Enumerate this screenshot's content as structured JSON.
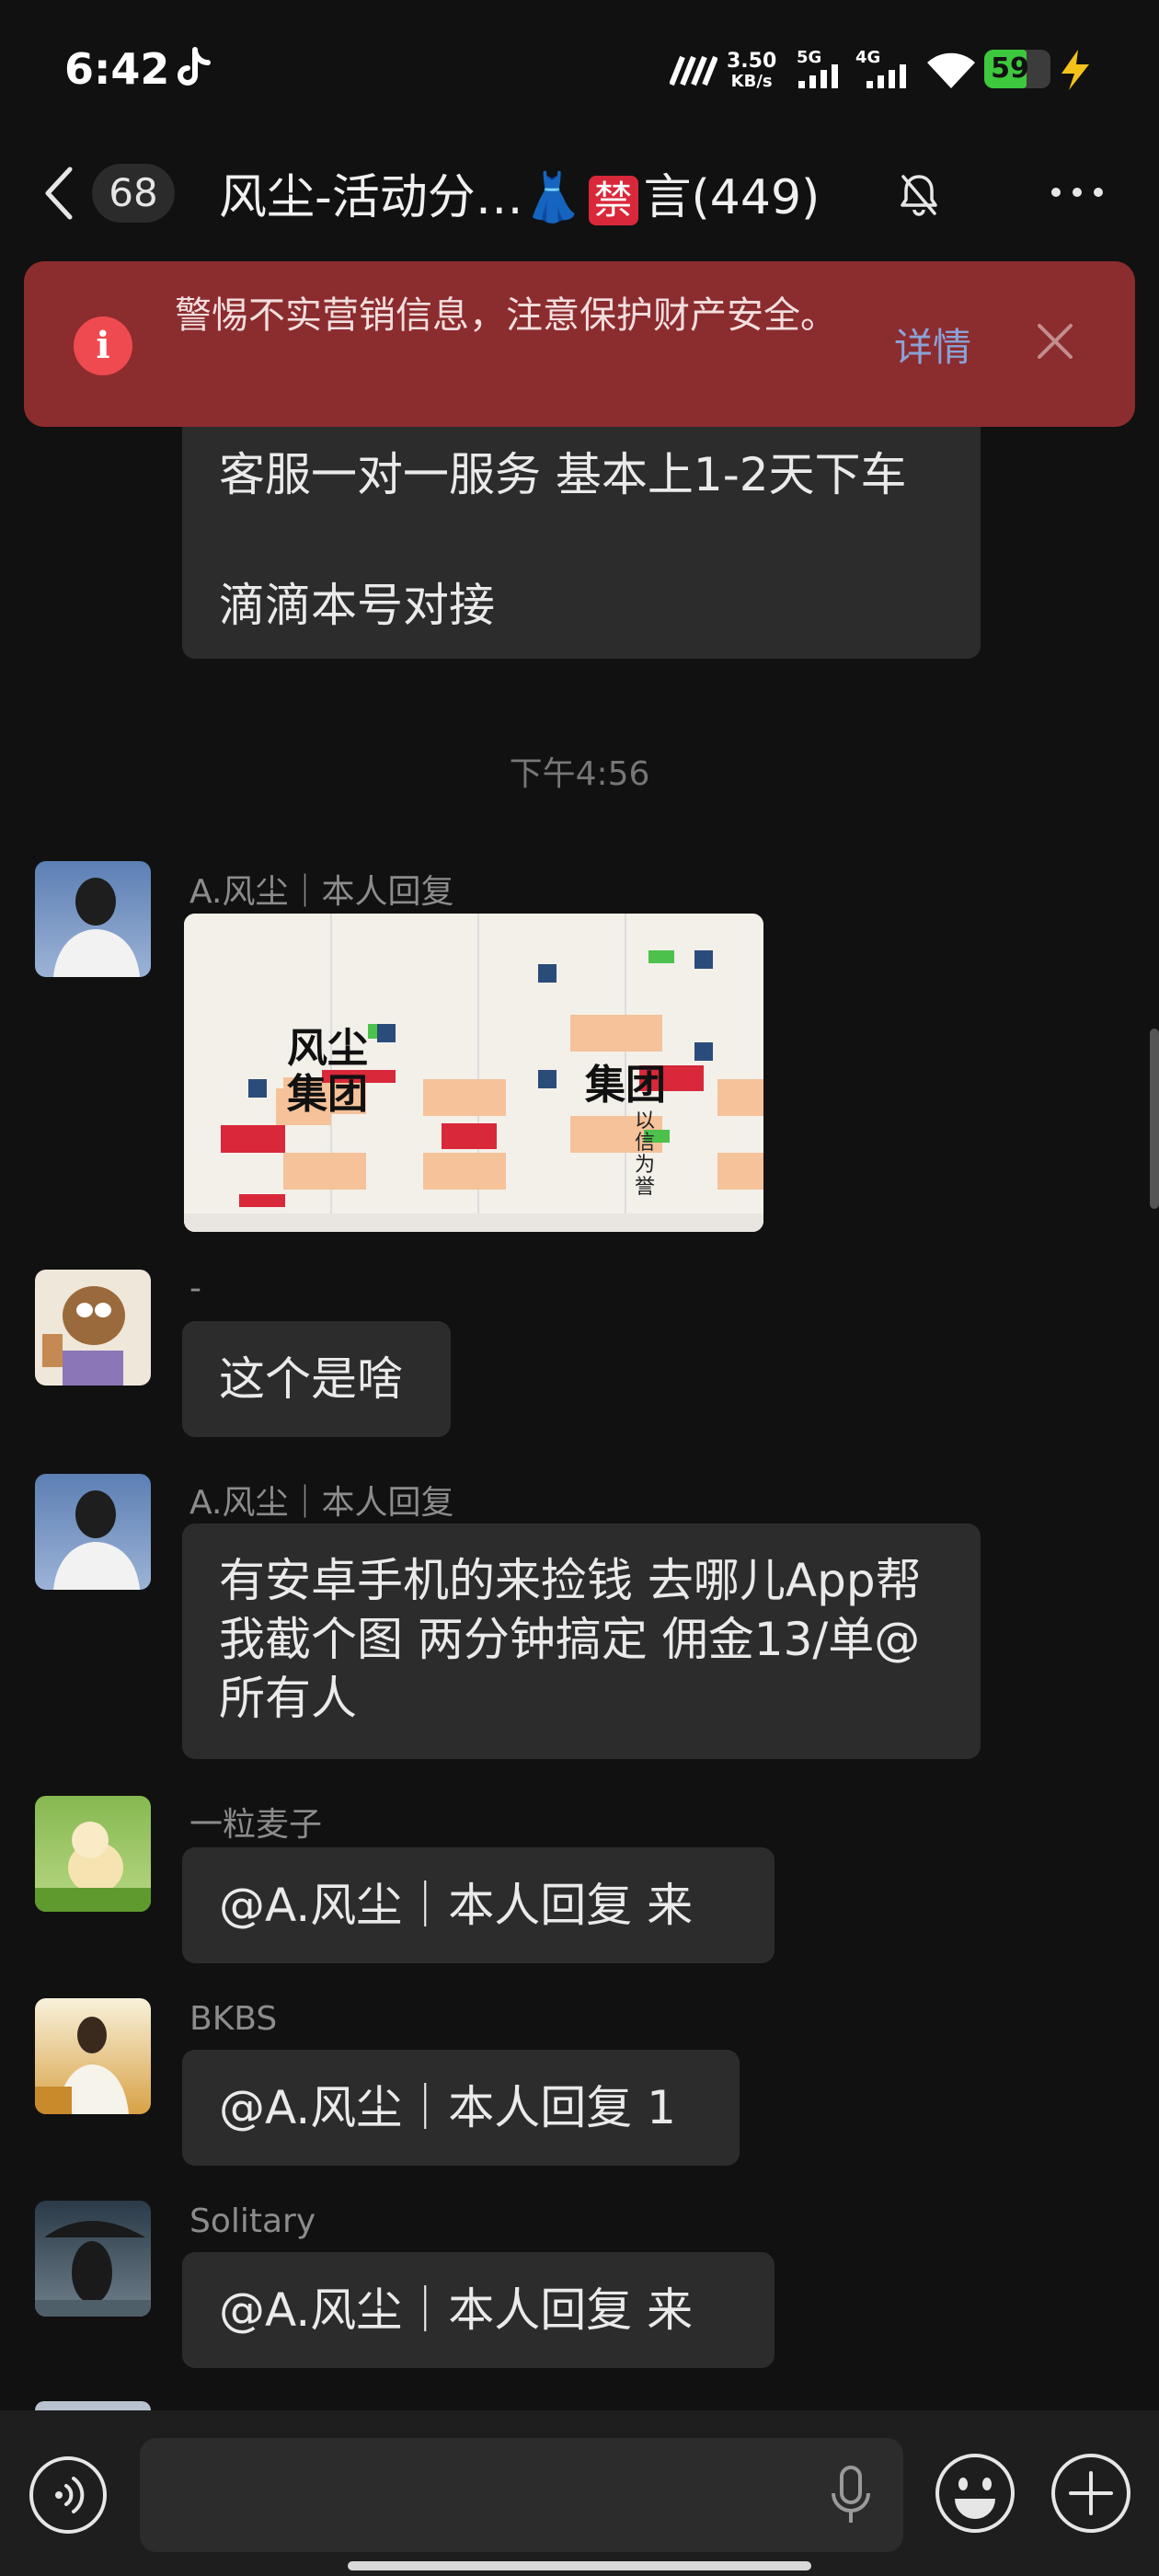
{
  "status_bar": {
    "time": "6:42",
    "net_speed_value": "3.50",
    "net_speed_unit": "KB/s",
    "signal_1": "5G",
    "signal_2": "4G",
    "battery": "59"
  },
  "title_bar": {
    "unread_count": "68",
    "title_prefix": "风尘-活动分…",
    "title_dress": "👗",
    "title_ban": "禁",
    "title_suffix": "言(449)"
  },
  "warning": {
    "text": "警惕不实营销信息，注意保护财产安全。",
    "detail_label": "详情"
  },
  "messages": {
    "partial_line1": "客服一对一服务 基本上1-2天下车",
    "partial_line2": "滴滴本号对接",
    "timestamp": "下午4:56",
    "m1_sender": "A.风尘｜本人回复",
    "m2_sender": "-",
    "m2_text": "这个是啥",
    "m3_sender": "A.风尘｜本人回复",
    "m3_text": "有安卓手机的来捡钱 去哪儿App帮我截个图 两分钟搞定 佣金13/单@所有人",
    "m4_sender": "一粒麦子",
    "m4_text": "@A.风尘｜本人回复  来",
    "m5_sender": "BKBS",
    "m5_text": "@A.风尘｜本人回复 1",
    "m6_sender": "Solitary",
    "m6_text": "@A.风尘｜本人回复  来"
  },
  "image_message": {
    "big_text_1": "风尘",
    "big_text_2": "集团",
    "big_text_3": "集团",
    "side_text": "以信为誉"
  },
  "input": {
    "placeholder": ""
  }
}
